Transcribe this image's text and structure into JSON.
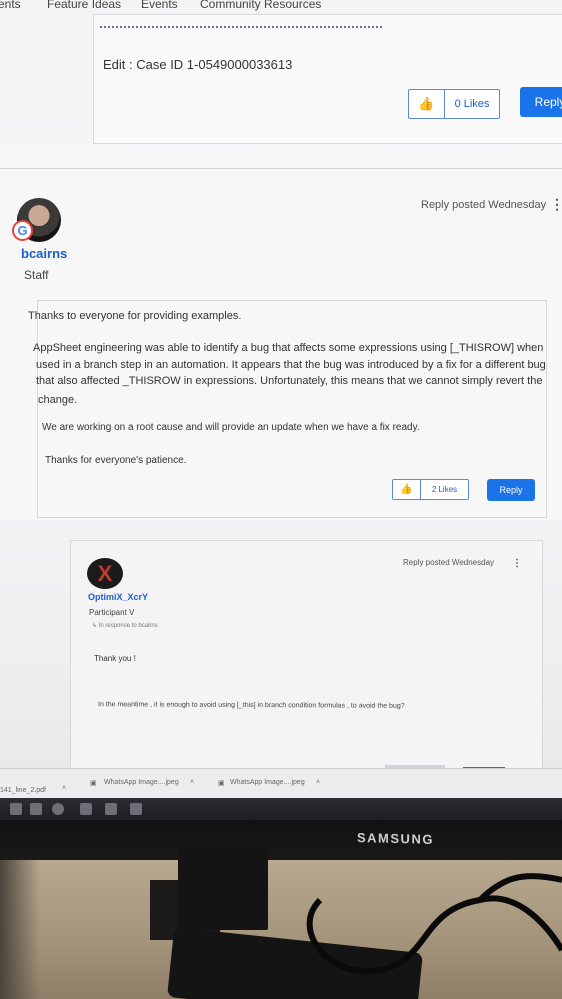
{
  "nav": {
    "items": [
      "ents",
      "Feature Ideas",
      "Events",
      "Community Resources"
    ]
  },
  "prev_post": {
    "edit_line": "Edit : Case ID 1-0549000033613",
    "likes": "0 Likes",
    "reply": "Reply"
  },
  "post1": {
    "author": "bcairns",
    "role": "Staff",
    "meta": "Reply posted Wednesday",
    "paragraphs": [
      "Thanks to everyone for providing examples.",
      "AppSheet engineering was able to identify a bug that affects some expressions using [_THISROW] when",
      "used in a branch step in an automation. It appears that the bug was introduced by a fix for a different bug",
      "that also affected _THISROW in expressions. Unfortunately, this means that we cannot simply revert the",
      "change.",
      "We are working on a root cause and will provide an update when we have a fix ready.",
      "Thanks for everyone's patience."
    ],
    "likes": "2 Likes",
    "reply": "Reply"
  },
  "post2": {
    "avatar_letter": "X",
    "author": "OptimiX_XcrY",
    "role": "Participant V",
    "in_response": "In response to bcairns",
    "meta": "Reply posted Wednesday",
    "line1": "Thank you !",
    "line2": "In the meantime , it is enough to avoid using [_this] in branch condition formulas , to avoid the bug?"
  },
  "downloads": {
    "item0": "141_line_2.pdf",
    "item1": "WhatsApp Image....jpeg",
    "item2": "WhatsApp Image....jpeg"
  },
  "monitor": {
    "brand": "SAMSUNG"
  },
  "colors": {
    "accent": "#1a73e8",
    "link": "#1a5fd0"
  }
}
